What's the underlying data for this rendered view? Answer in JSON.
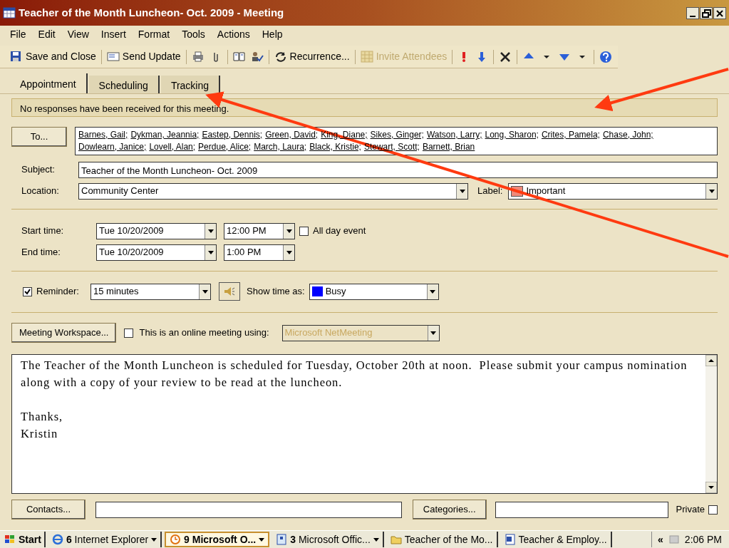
{
  "window": {
    "title": "Teacher of the Month Luncheon- Oct. 2009 - Meeting"
  },
  "menu": [
    "File",
    "Edit",
    "View",
    "Insert",
    "Format",
    "Tools",
    "Actions",
    "Help"
  ],
  "toolbar": [
    {
      "kind": "button",
      "label": "Save and Close"
    },
    {
      "kind": "separator"
    },
    {
      "kind": "button",
      "label": "Send Update"
    },
    {
      "kind": "separator"
    },
    {
      "kind": "icon"
    },
    {
      "kind": "icon"
    },
    {
      "kind": "separator"
    },
    {
      "kind": "icon"
    },
    {
      "kind": "icon"
    },
    {
      "kind": "separator"
    },
    {
      "kind": "button",
      "label": "Recurrence..."
    },
    {
      "kind": "separator"
    },
    {
      "kind": "button",
      "label": "Invite Attendees",
      "disabled": true
    },
    {
      "kind": "separator"
    },
    {
      "kind": "icon"
    },
    {
      "kind": "icon"
    },
    {
      "kind": "separator"
    },
    {
      "kind": "icon"
    },
    {
      "kind": "separator"
    },
    {
      "kind": "icon"
    },
    {
      "kind": "icon"
    },
    {
      "kind": "icon"
    },
    {
      "kind": "icon"
    },
    {
      "kind": "separator"
    },
    {
      "kind": "icon"
    }
  ],
  "tabs": [
    {
      "label": "Appointment",
      "selected": true
    },
    {
      "label": "Scheduling",
      "selected": false
    },
    {
      "label": "Tracking",
      "selected": false
    }
  ],
  "info_bar": "No responses have been received for this meeting.",
  "to_button": "To...",
  "recipients": [
    "Barnes, Gail;",
    "Dykman, Jeannia;",
    "Eastep, Dennis;",
    "Green, David;",
    "King, Diane;",
    "Sikes, Ginger;",
    "Watson, Larry;",
    "Long, Sharon;",
    "Crites, Pamela;",
    "Chase, John;",
    "Dowlearn, Janice;",
    "Lovell, Alan;",
    "Perdue, Alice;",
    "March, Laura;",
    "Black, Kristie;",
    "Stewart, Scott;",
    "Barnett, Brian"
  ],
  "subject": {
    "label": "Subject:",
    "value": "Teacher of the Month Luncheon- Oct. 2009"
  },
  "location": {
    "label": "Location:",
    "value": "Community Center"
  },
  "label": {
    "label": "Label:",
    "value": "Important",
    "color": "#f08a7a"
  },
  "start": {
    "label": "Start time:",
    "date": "Tue 10/20/2009",
    "time": "12:00 PM"
  },
  "end": {
    "label": "End time:",
    "date": "Tue 10/20/2009",
    "time": "1:00 PM"
  },
  "all_day": {
    "label": "All day event",
    "checked": false
  },
  "reminder": {
    "label": "Reminder:",
    "checked": true,
    "value": "15 minutes"
  },
  "show_time_as": {
    "label": "Show time as:",
    "value": "Busy",
    "color": "#0000ff"
  },
  "workspace_button": "Meeting Workspace...",
  "online": {
    "label": "This is an online meeting using:",
    "checked": false,
    "value": "Microsoft NetMeeting",
    "disabled": true
  },
  "body": [
    [
      "The Teacher of the Month Luncheon is scheduled for Tuesday, October 20th at noon.  Please submit your campus nomination",
      "along with a copy of your review to be read at the luncheon."
    ],
    [
      "Thanks,",
      "Kristin"
    ]
  ],
  "contacts_button": "Contacts...",
  "categories_button": "Categories...",
  "private": {
    "label": "Private",
    "checked": false
  },
  "taskbar": {
    "start": "Start",
    "items": [
      {
        "label": "**6** Internet Explorer",
        "selected": false
      },
      {
        "label": "**9 Microsoft O...**",
        "selected": true
      },
      {
        "label": "**3** Microsoft Offic...",
        "selected": false
      },
      {
        "label": "Teacher of the Mo...",
        "selected": false
      },
      {
        "label": "Teacher & Employ...",
        "selected": false
      }
    ],
    "tray": "«",
    "clock": "2:06 PM"
  }
}
